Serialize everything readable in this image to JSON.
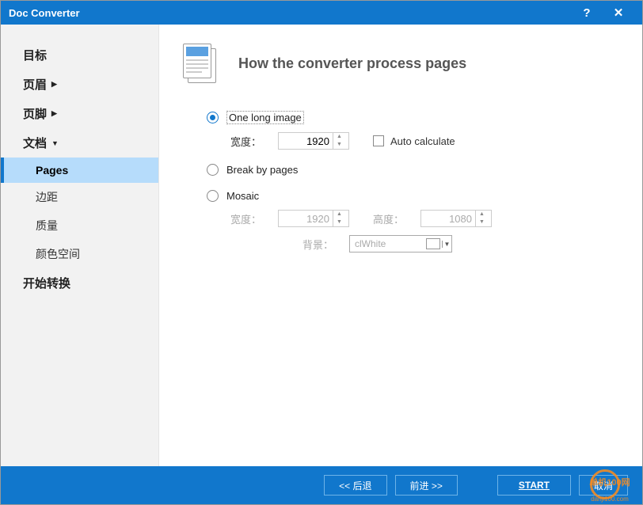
{
  "titlebar": {
    "title": "Doc Converter"
  },
  "sidebar": {
    "items": [
      {
        "label": "目标",
        "expandable": false
      },
      {
        "label": "页眉",
        "expandable": true
      },
      {
        "label": "页脚",
        "expandable": true
      },
      {
        "label": "文档",
        "expandable": true,
        "expanded": true
      }
    ],
    "doc_subs": [
      {
        "label": "Pages",
        "active": true
      },
      {
        "label": "边距"
      },
      {
        "label": "质量"
      },
      {
        "label": "颜色空间"
      }
    ],
    "last": {
      "label": "开始转换"
    }
  },
  "main": {
    "heading": "How the converter process pages",
    "options": {
      "one_long": {
        "label": "One long image",
        "selected": true,
        "width": {
          "label": "宽度：",
          "value": "1920"
        },
        "auto_calc": {
          "label": "Auto calculate",
          "checked": false
        }
      },
      "break_pages": {
        "label": "Break by pages",
        "selected": false
      },
      "mosaic": {
        "label": "Mosaic",
        "selected": false,
        "width": {
          "label": "宽度：",
          "value": "1920"
        },
        "height": {
          "label": "高度：",
          "value": "1080"
        },
        "bg": {
          "label": "背景：",
          "value": "clWhite"
        }
      }
    }
  },
  "footer": {
    "back": "<<  后退",
    "forward": "前进  >>",
    "start": "START",
    "cancel": "取消"
  },
  "watermark": {
    "text1": "单机100网",
    "text2": "danji100.com"
  }
}
